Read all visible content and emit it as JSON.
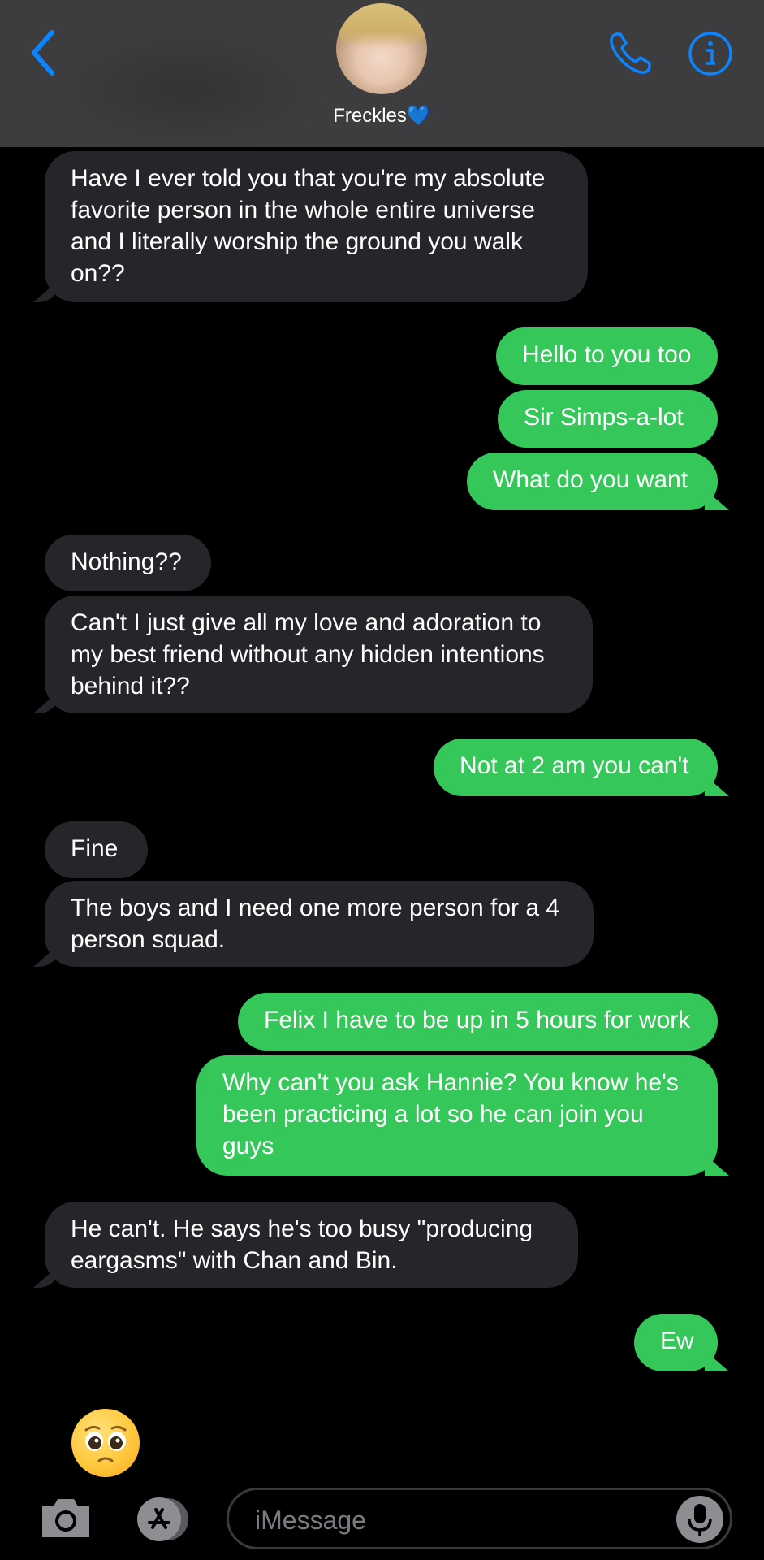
{
  "colors": {
    "accent": "#0a84ff",
    "sent_bubble": "#35c759",
    "received_bubble": "#262529",
    "header_bg": "#3d3d3f",
    "background": "#000000"
  },
  "header": {
    "contact_name": "Freckles💙",
    "back_icon": "chevron-left-icon",
    "phone_icon": "phone-icon",
    "info_icon": "info-icon"
  },
  "messages": [
    {
      "from": "them",
      "text": "Have I ever told you that you're my absolute\nfavorite person in the whole entire universe\nand I literally worship the ground you walk\non??"
    },
    {
      "from": "me",
      "text": "Hello to you too"
    },
    {
      "from": "me",
      "text": "Sir Simps-a-lot"
    },
    {
      "from": "me",
      "text": "What do you want"
    },
    {
      "from": "them",
      "text": "Nothing??"
    },
    {
      "from": "them",
      "text": "Can't I just give all my love and adoration to\nmy best friend without any hidden intentions\nbehind it??"
    },
    {
      "from": "me",
      "text": "Not at 2 am you can't"
    },
    {
      "from": "them",
      "text": "Fine"
    },
    {
      "from": "them",
      "text": "The boys and I need one more person for a 4\nperson squad."
    },
    {
      "from": "me",
      "text": "Felix I have to be up in 5 hours for work"
    },
    {
      "from": "me",
      "text": "Why can't you ask Hannie? You know he's\nbeen practicing a lot so he can join you\nguys"
    },
    {
      "from": "them",
      "text": "He can't. He says he's too busy \"producing\neargasms\" with Chan and Bin."
    },
    {
      "from": "me",
      "text": "Ew"
    }
  ],
  "typing_emoji": "🥺",
  "input_bar": {
    "placeholder": "iMessage",
    "camera_icon": "camera-icon",
    "apps_icon": "app-store-icon",
    "mic_icon": "microphone-icon"
  }
}
